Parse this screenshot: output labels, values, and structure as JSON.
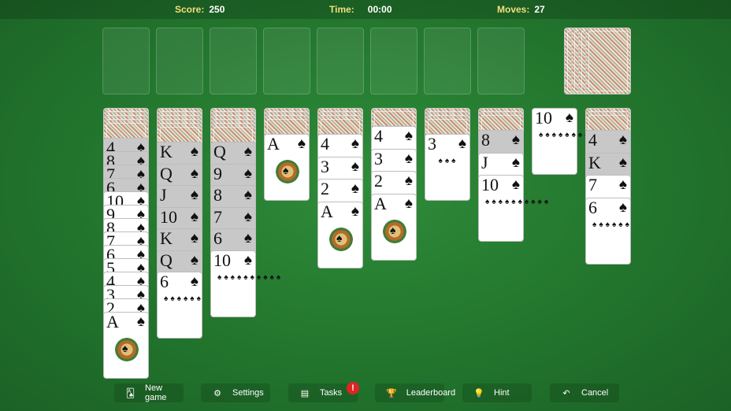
{
  "stats": {
    "score_label": "Score:",
    "score": "250",
    "time_label": "Time:",
    "time": "00:00",
    "moves_label": "Moves:",
    "moves": "27"
  },
  "foundations": 8,
  "stock_piles": 4,
  "tableau": [
    {
      "backs": 4,
      "faces": [
        {
          "rank": "4",
          "suit": "♠",
          "dim": true
        },
        {
          "rank": "8",
          "suit": "♠",
          "dim": true
        },
        {
          "rank": "7",
          "suit": "♠",
          "dim": true
        },
        {
          "rank": "6",
          "suit": "♠",
          "dim": true
        },
        {
          "rank": "10",
          "suit": "♠"
        },
        {
          "rank": "9",
          "suit": "♠"
        },
        {
          "rank": "8",
          "suit": "♠"
        },
        {
          "rank": "7",
          "suit": "♠"
        },
        {
          "rank": "6",
          "suit": "♠"
        },
        {
          "rank": "5",
          "suit": "♠"
        },
        {
          "rank": "4",
          "suit": "♠"
        },
        {
          "rank": "3",
          "suit": "♠"
        },
        {
          "rank": "2",
          "suit": "♠"
        },
        {
          "rank": "A",
          "suit": "♠"
        }
      ]
    },
    {
      "backs": 5,
      "faces": [
        {
          "rank": "K",
          "suit": "♠",
          "dim": true
        },
        {
          "rank": "Q",
          "suit": "♠",
          "dim": true
        },
        {
          "rank": "J",
          "suit": "♠",
          "dim": true
        },
        {
          "rank": "10",
          "suit": "♠",
          "dim": true
        },
        {
          "rank": "K",
          "suit": "♠",
          "dim": true
        },
        {
          "rank": "Q",
          "suit": "♠",
          "dim": true
        },
        {
          "rank": "6",
          "suit": "♠"
        }
      ]
    },
    {
      "backs": 5,
      "faces": [
        {
          "rank": "Q",
          "suit": "♠",
          "dim": true
        },
        {
          "rank": "9",
          "suit": "♠",
          "dim": true
        },
        {
          "rank": "8",
          "suit": "♠",
          "dim": true
        },
        {
          "rank": "7",
          "suit": "♠",
          "dim": true
        },
        {
          "rank": "6",
          "suit": "♠",
          "dim": true
        },
        {
          "rank": "10",
          "suit": "♠"
        }
      ]
    },
    {
      "backs": 3,
      "faces": [
        {
          "rank": "A",
          "suit": "♠"
        }
      ]
    },
    {
      "backs": 3,
      "faces": [
        {
          "rank": "4",
          "suit": "♠"
        },
        {
          "rank": "3",
          "suit": "♠"
        },
        {
          "rank": "2",
          "suit": "♠"
        },
        {
          "rank": "A",
          "suit": "♠"
        }
      ]
    },
    {
      "backs": 1,
      "faces": [
        {
          "rank": "4",
          "suit": "♠"
        },
        {
          "rank": "3",
          "suit": "♠"
        },
        {
          "rank": "2",
          "suit": "♠"
        },
        {
          "rank": "A",
          "suit": "♠"
        }
      ]
    },
    {
      "backs": 3,
      "faces": [
        {
          "rank": "3",
          "suit": "♠"
        }
      ]
    },
    {
      "backs": 2,
      "faces": [
        {
          "rank": "8",
          "suit": "♠",
          "dim": true
        },
        {
          "rank": "J",
          "suit": "♠"
        },
        {
          "rank": "10",
          "suit": "♠"
        }
      ]
    },
    {
      "backs": 0,
      "faces": [
        {
          "rank": "10",
          "suit": "♠"
        }
      ]
    },
    {
      "backs": 2,
      "faces": [
        {
          "rank": "4",
          "suit": "♠",
          "dim": true
        },
        {
          "rank": "K",
          "suit": "♠",
          "dim": true
        },
        {
          "rank": "7",
          "suit": "♠"
        },
        {
          "rank": "6",
          "suit": "♠"
        }
      ]
    }
  ],
  "buttons": [
    {
      "name": "new-game-button",
      "icon_name": "card-icon",
      "icon": "🂡",
      "label": "New game"
    },
    {
      "name": "settings-button",
      "icon_name": "gear-icon",
      "icon": "⚙",
      "label": "Settings"
    },
    {
      "name": "tasks-button",
      "icon_name": "clipboard-icon",
      "icon": "▤",
      "label": "Tasks"
    },
    {
      "name": "leaderboard-button",
      "icon_name": "trophy-icon",
      "icon": "🏆",
      "label": "Leaderboard"
    },
    {
      "name": "hint-button",
      "icon_name": "lightbulb-icon",
      "icon": "💡",
      "label": "Hint"
    },
    {
      "name": "cancel-button",
      "icon_name": "undo-icon",
      "icon": "↶",
      "label": "Cancel"
    }
  ],
  "tasks_badge": "!"
}
